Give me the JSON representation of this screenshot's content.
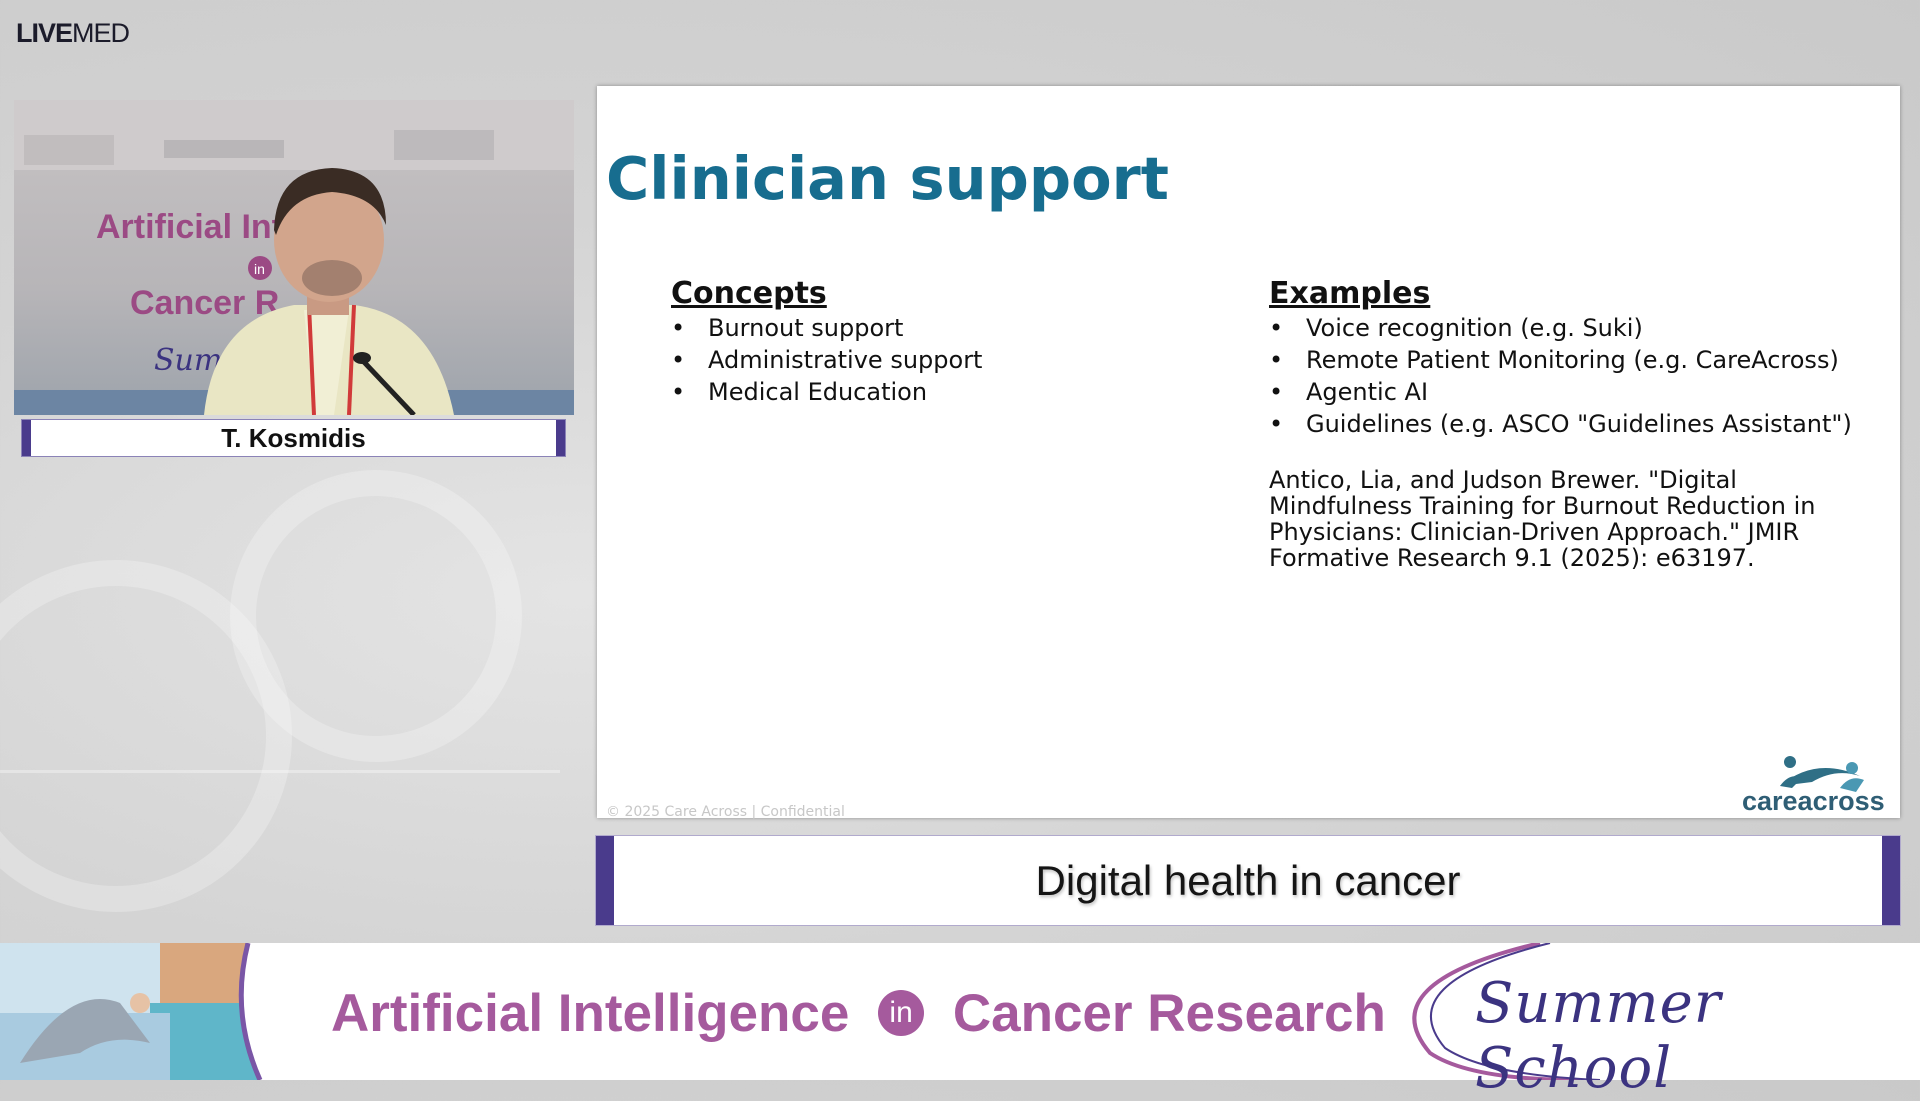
{
  "logo": {
    "bold": "LIVE",
    "light": "MED"
  },
  "speaker": {
    "name": "T. Kosmidis",
    "backdrop_text": [
      "Artificial Inte",
      "in",
      "Cancer R",
      "Sum"
    ]
  },
  "slide": {
    "title": "Clinician support",
    "concepts": {
      "heading": "Concepts",
      "items": [
        "Burnout support",
        "Administrative support",
        "Medical Education"
      ]
    },
    "examples": {
      "heading": "Examples",
      "items": [
        "Voice recognition (e.g. Suki)",
        "Remote Patient Monitoring (e.g. CareAcross)",
        "Agentic AI",
        "Guidelines (e.g. ASCO \"Guidelines Assistant\")"
      ],
      "citation": "Antico, Lia, and Judson Brewer. \"Digital Mindfulness Training for Burnout Reduction in Physicians: Clinician-Driven Approach.\" JMIR Formative Research 9.1 (2025): e63197."
    },
    "footer": "© 2025 Care Across   |   Confidential",
    "brand_logo_text": "careacross"
  },
  "topic_bar": {
    "label": "Digital health in cancer"
  },
  "banner": {
    "title_left": "Artificial Intelligence",
    "title_in": "in",
    "title_right": "Cancer Research",
    "summer_school": "Summer School"
  },
  "colors": {
    "accent_purple": "#4a3b8c",
    "banner_pink": "#a55a9d",
    "slide_title": "#176d8f"
  }
}
